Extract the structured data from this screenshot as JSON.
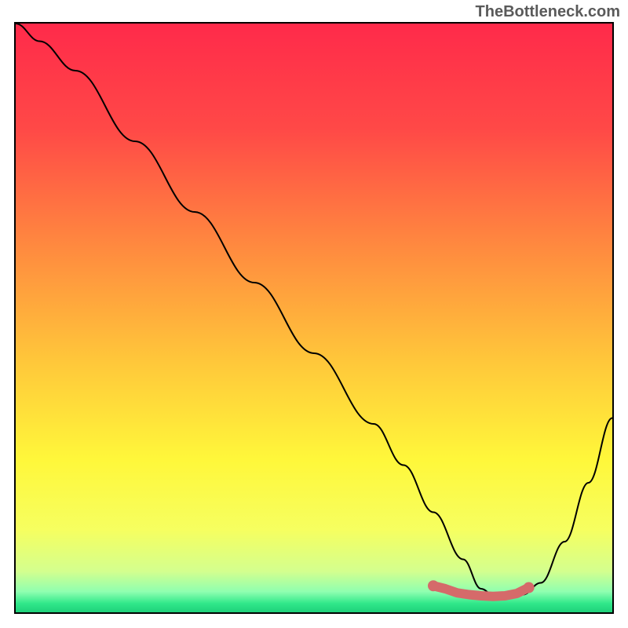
{
  "watermark": "TheBottleneck.com",
  "gradient_stops": [
    {
      "offset": 0,
      "color": "#ff2a4a"
    },
    {
      "offset": 0.18,
      "color": "#ff4947"
    },
    {
      "offset": 0.38,
      "color": "#ff8a3f"
    },
    {
      "offset": 0.58,
      "color": "#ffc93a"
    },
    {
      "offset": 0.74,
      "color": "#fff73a"
    },
    {
      "offset": 0.86,
      "color": "#f6ff60"
    },
    {
      "offset": 0.93,
      "color": "#d4ff8e"
    },
    {
      "offset": 0.965,
      "color": "#8fffb0"
    },
    {
      "offset": 0.985,
      "color": "#30e88a"
    },
    {
      "offset": 1.0,
      "color": "#1fd07a"
    }
  ],
  "marker_color": "#d56a6a",
  "chart_data": {
    "type": "line",
    "title": "",
    "xlabel": "",
    "ylabel": "",
    "xlim": [
      0,
      100
    ],
    "ylim": [
      0,
      100
    ],
    "series": [
      {
        "name": "bottleneck-curve",
        "x": [
          0,
          4,
          10,
          20,
          30,
          40,
          50,
          60,
          65,
          70,
          75,
          78,
          80,
          82,
          85,
          88,
          92,
          96,
          100
        ],
        "y": [
          100,
          97,
          92,
          80,
          68,
          56,
          44,
          32,
          25,
          17,
          9,
          4,
          3,
          2.5,
          3,
          5,
          12,
          22,
          33
        ]
      }
    ],
    "markers": {
      "name": "optimal-range",
      "x": [
        70,
        72,
        74,
        76,
        78,
        80,
        82,
        84,
        86
      ],
      "y": [
        4.5,
        4.0,
        3.3,
        3.0,
        2.8,
        2.7,
        2.8,
        3.2,
        4.2
      ]
    }
  }
}
